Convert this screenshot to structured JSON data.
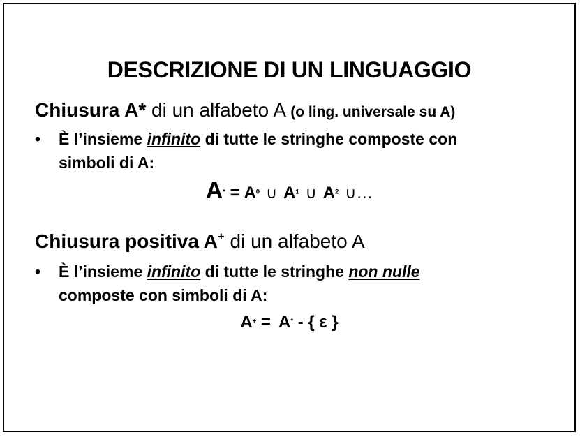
{
  "slide": {
    "title": "DESCRIZIONE DI UN LINGUAGGIO",
    "section1": {
      "heading_bold": "Chiusura A*",
      "heading_normal": " di un alfabeto A ",
      "heading_small": "(o ling. universale su A)",
      "bullet_marker": "•",
      "bullet_line1_pre": "È l’insieme ",
      "bullet_line1_em": "infinito",
      "bullet_line1_post": " di tutte le stringhe composte con",
      "bullet_line2": "simboli di A:",
      "formula": {
        "lhs": "A",
        "lhs_sup": "*",
        "eq": " = ",
        "t0": "A",
        "t0_sup": "0",
        "cup": "∪",
        "t1": "A",
        "t1_sup": "1",
        "t2": "A",
        "t2_sup": "2",
        "ellipsis": "…"
      }
    },
    "section2": {
      "heading_bold": "Chiusura positiva A",
      "heading_sup": "+",
      "heading_normal": " di un alfabeto A",
      "bullet_marker": "•",
      "bullet_line1_pre": "È l’insieme ",
      "bullet_line1_em1": "infinito",
      "bullet_line1_mid": " di tutte le stringhe ",
      "bullet_line1_em2": "non nulle",
      "bullet_line2": "composte con simboli di A:",
      "formula": {
        "lhs": "A",
        "lhs_sup": "+",
        "eq": " = ",
        "rhs": "A",
        "rhs_sup": "*",
        "rest": " - { ε }"
      }
    }
  }
}
